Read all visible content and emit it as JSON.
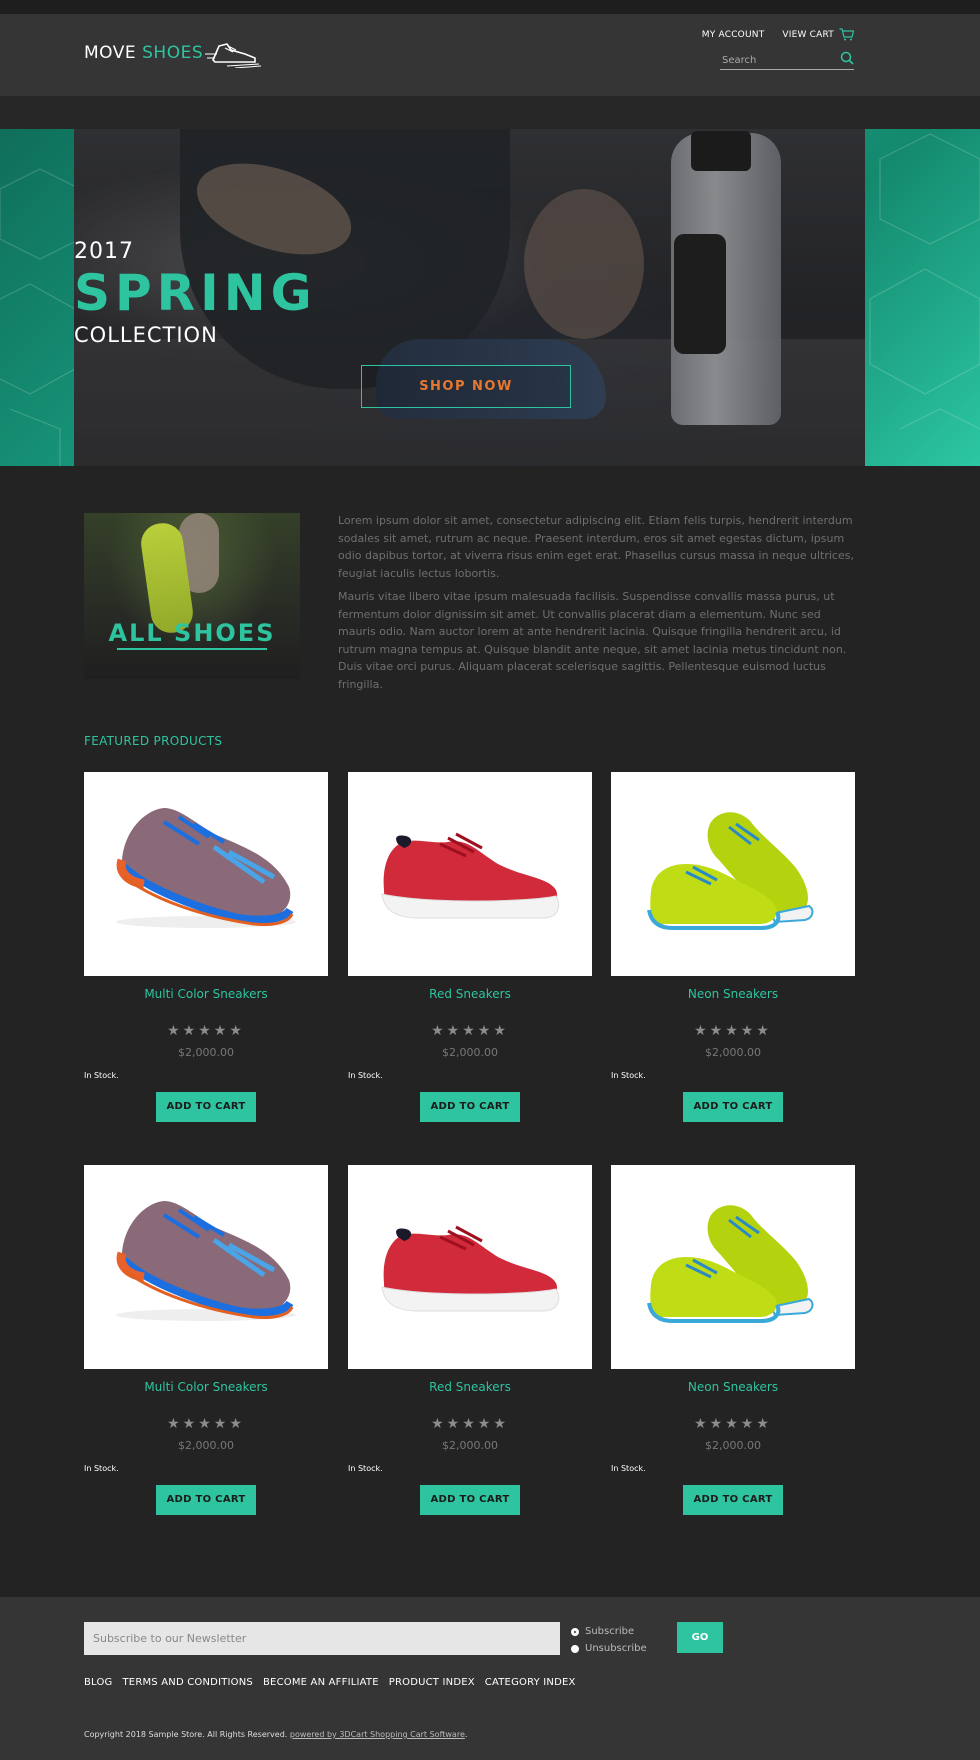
{
  "brand": {
    "name_part1": "MOVE",
    "name_part2": "SHOES"
  },
  "header": {
    "my_account": "MY ACCOUNT",
    "view_cart": "VIEW CART",
    "search_placeholder": "Search"
  },
  "hero": {
    "year": "2017",
    "title": "SPRING",
    "subtitle": "COLLECTION",
    "cta": "SHOP NOW"
  },
  "category_tile": {
    "label": "ALL SHOES"
  },
  "intro": {
    "paragraphs": [
      "Lorem ipsum dolor sit amet, consectetur adipiscing elit. Etiam felis turpis, hendrerit interdum sodales sit amet, rutrum ac neque. Praesent interdum, eros sit amet egestas dictum, ipsum odio dapibus tortor, at viverra risus enim eget erat. Phasellus cursus massa in neque ultrices, feugiat iaculis lectus lobortis.",
      "Mauris vitae libero vitae ipsum malesuada facilisis. Suspendisse convallis massa purus, ut fermentum dolor dignissim sit amet. Ut convallis placerat diam a elementum. Nunc sed mauris odio. Nam auctor lorem at ante hendrerit lacinia. Quisque fringilla hendrerit arcu, id rutrum magna tempus at. Quisque blandit ante neque, sit amet lacinia metus tincidunt non. Duis vitae orci purus. Aliquam placerat scelerisque sagittis. Pellentesque euismod luctus fringilla."
    ]
  },
  "featured": {
    "title": "FEATURED PRODUCTS",
    "products": [
      {
        "name": "Multi Color Sneakers",
        "rating": 5,
        "stars": "★★★★★",
        "price": "$2,000.00",
        "stock": "In Stock.",
        "button": "ADD TO CART",
        "image": "multicolor-sneaker"
      },
      {
        "name": "Red Sneakers",
        "rating": 5,
        "stars": "★★★★★",
        "price": "$2,000.00",
        "stock": "In Stock.",
        "button": "ADD TO CART",
        "image": "red-sneaker"
      },
      {
        "name": "Neon Sneakers",
        "rating": 5,
        "stars": "★★★★★",
        "price": "$2,000.00",
        "stock": "In Stock.",
        "button": "ADD TO CART",
        "image": "neon-sneakers"
      },
      {
        "name": "Multi Color Sneakers",
        "rating": 5,
        "stars": "★★★★★",
        "price": "$2,000.00",
        "stock": "In Stock.",
        "button": "ADD TO CART",
        "image": "multicolor-sneaker"
      },
      {
        "name": "Red Sneakers",
        "rating": 5,
        "stars": "★★★★★",
        "price": "$2,000.00",
        "stock": "In Stock.",
        "button": "ADD TO CART",
        "image": "red-sneaker"
      },
      {
        "name": "Neon Sneakers",
        "rating": 5,
        "stars": "★★★★★",
        "price": "$2,000.00",
        "stock": "In Stock.",
        "button": "ADD TO CART",
        "image": "neon-sneakers"
      }
    ]
  },
  "footer": {
    "newsletter_placeholder": "Subscribe to our Newsletter",
    "subscribe_label": "Subscribe",
    "unsubscribe_label": "Unsubscribe",
    "go_label": "GO",
    "links": [
      "BLOG",
      "TERMS AND CONDITIONS",
      "BECOME AN AFFILIATE",
      "PRODUCT INDEX",
      "CATEGORY INDEX"
    ],
    "copyright": "Copyright 2018 Sample Store. All Rights Reserved.",
    "powered_by": "powered by 3DCart Shopping Cart Software"
  },
  "colors": {
    "accent": "#2ec4a0",
    "cta_text": "#e8782f",
    "background": "#232323",
    "header_bg": "#353535"
  },
  "icons": {
    "cart": "cart-icon",
    "search": "search-icon",
    "logo": "running-shoe-icon"
  }
}
